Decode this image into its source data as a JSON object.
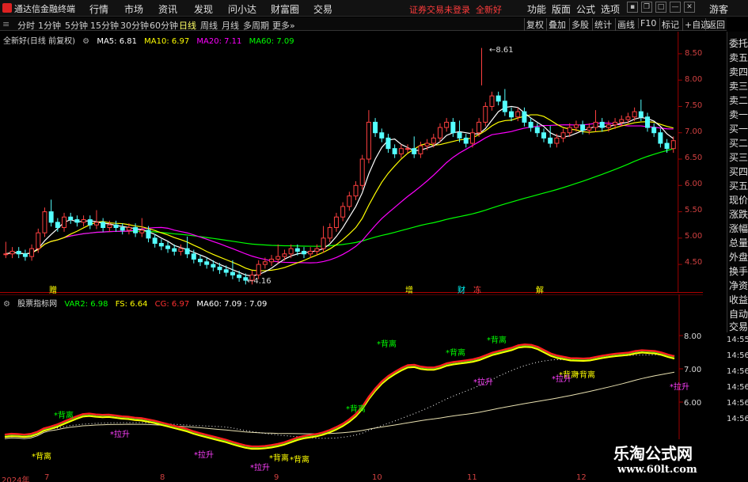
{
  "app": {
    "title": "通达信金融终端",
    "menu": [
      "行情",
      "市场",
      "资讯",
      "发现",
      "问小达",
      "财富圈",
      "交易"
    ],
    "login_status": "证券交易未登录",
    "stock_name_top": "全新好",
    "right_menu": [
      "功能",
      "版面",
      "公式",
      "选项"
    ],
    "guest": "游客"
  },
  "toolbar": {
    "periods": [
      "分时",
      "1分钟",
      "5分钟",
      "15分钟",
      "30分钟",
      "60分钟",
      "日线",
      "周线",
      "月线",
      "多周期",
      "更多"
    ],
    "active": "日线",
    "right_buttons": [
      "复权",
      "叠加",
      "多股",
      "统计",
      "画线",
      "F10",
      "标记",
      "+自选",
      "返回"
    ]
  },
  "main_legend": {
    "title": "全新好(日线 前复权)",
    "ma5": "MA5: 6.81",
    "ma10": "MA10: 6.97",
    "ma20": "MA20: 7.11",
    "ma60": "MA60: 7.09"
  },
  "sub_legend": {
    "title": "股票指标网",
    "var2": "VAR2: 6.98",
    "fs": "FS: 6.64",
    "cg": "CG: 6.97",
    "ma60": "MA60: 7.09 : 7.09"
  },
  "price_axis": [
    "8.50",
    "8.00",
    "7.50",
    "7.00",
    "6.50",
    "6.00",
    "5.50",
    "5.00",
    "4.50"
  ],
  "sub_axis": [
    "8.00",
    "7.00",
    "6.00"
  ],
  "sidebar_labels": [
    "委托",
    "卖五",
    "卖四",
    "卖三",
    "卖二",
    "卖一",
    "买一",
    "买二",
    "买三",
    "买四",
    "买五",
    "现价",
    "涨跌",
    "涨幅",
    "总量",
    "外盘",
    "换手",
    "净资",
    "收益",
    "自动",
    "交易"
  ],
  "time_labels": [
    "14:55",
    "14:56",
    "14:56",
    "14:56",
    "14:56",
    "14:56"
  ],
  "annotations": {
    "high_price": "8.61",
    "low_price": "4.16",
    "events": [
      "赠",
      "增",
      "财",
      "冻",
      "解"
    ]
  },
  "signals": {
    "beili": "背离",
    "lasheng": "拉升"
  },
  "date_labels": [
    "2024年",
    "7",
    "8",
    "9",
    "10",
    "11",
    "12"
  ],
  "watermark": {
    "cn": "乐淘公式网",
    "url": "www.60lt.com"
  },
  "colors": {
    "ma5": "#ffffff",
    "ma10": "#ffff00",
    "ma20": "#ff00ff",
    "ma60": "#00ff00",
    "up": "#ff4040",
    "down": "#54ffff",
    "axis": "#d04040"
  }
}
